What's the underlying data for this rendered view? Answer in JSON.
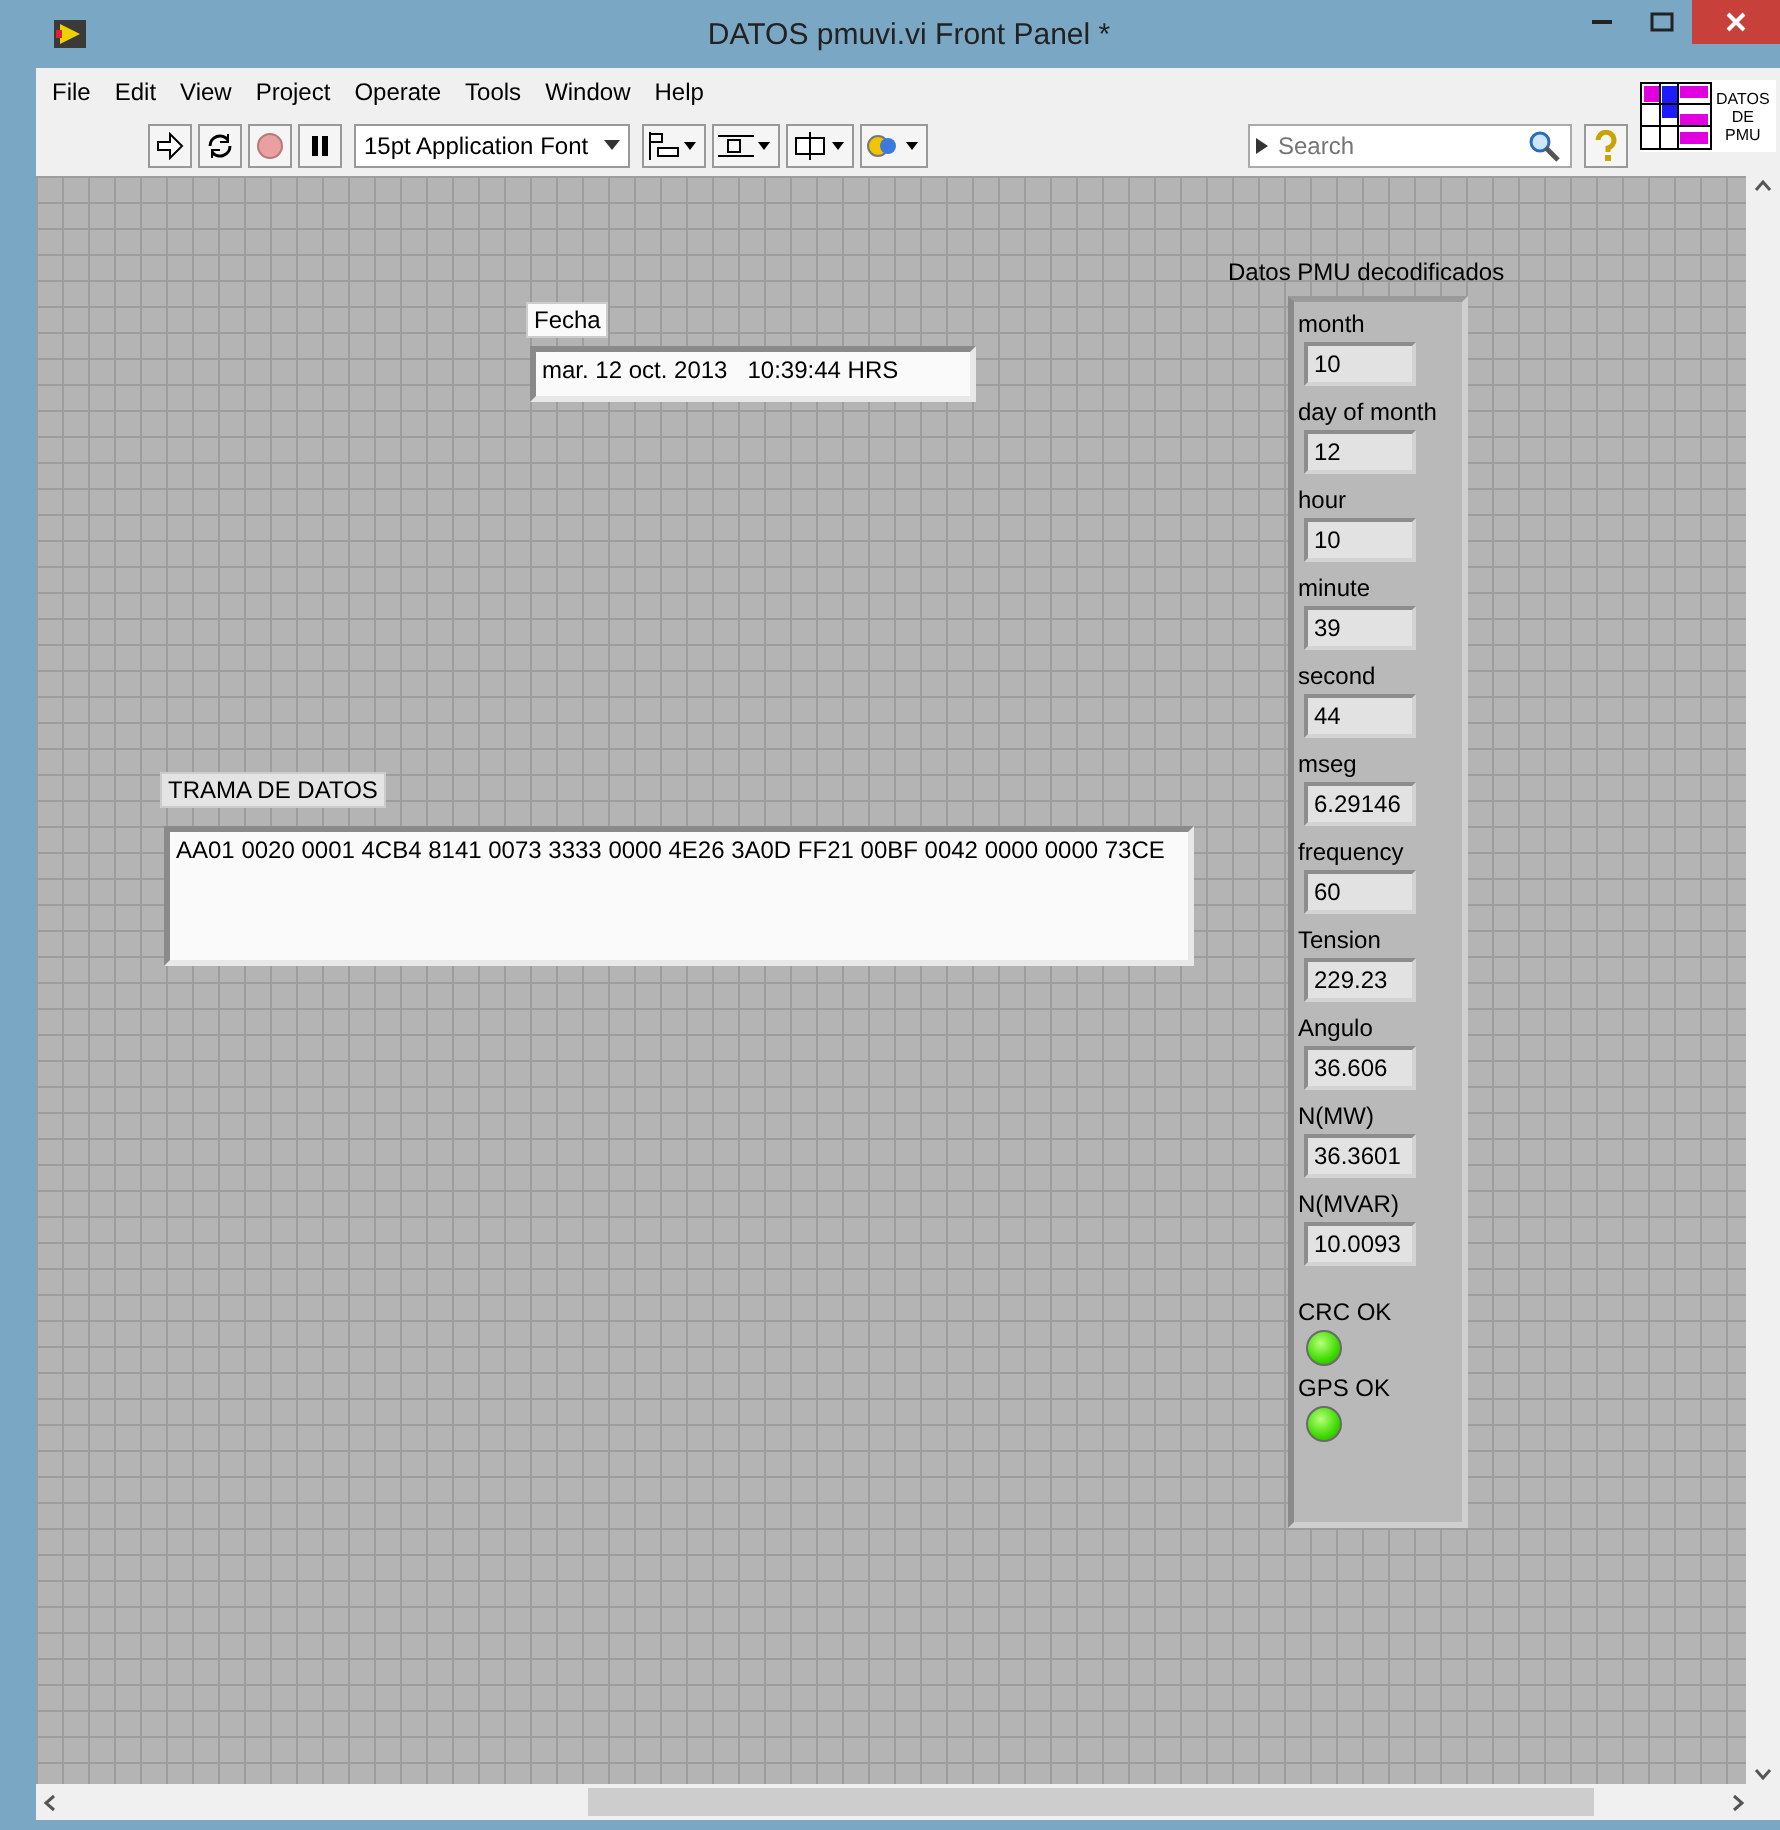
{
  "window": {
    "title": "DATOS pmuvi.vi Front Panel *"
  },
  "menu": [
    "File",
    "Edit",
    "View",
    "Project",
    "Operate",
    "Tools",
    "Window",
    "Help"
  ],
  "toolbar": {
    "font": "15pt Application Font",
    "search": {
      "placeholder": "Search"
    }
  },
  "vi_icon": {
    "lines": [
      "DATOS",
      "DE",
      "PMU"
    ]
  },
  "fecha": {
    "label": "Fecha",
    "value": "mar. 12 oct. 2013   10:39:44 HRS"
  },
  "trama": {
    "label": "TRAMA DE DATOS",
    "value": "AA01 0020 0001 4CB4 8141 0073 3333 0000 4E26 3A0D FF21 00BF 0042 0000 0000 73CE"
  },
  "cluster": {
    "label": "Datos PMU decodificados",
    "fields": [
      {
        "kind": "numeric",
        "label": "month",
        "value": "10"
      },
      {
        "kind": "numeric",
        "label": "day of month",
        "value": "12"
      },
      {
        "kind": "numeric",
        "label": "hour",
        "value": "10"
      },
      {
        "kind": "numeric",
        "label": "minute",
        "value": "39"
      },
      {
        "kind": "numeric",
        "label": "second",
        "value": "44"
      },
      {
        "kind": "numeric",
        "label": "mseg",
        "value": "6.29146"
      },
      {
        "kind": "numeric",
        "label": "frequency",
        "value": "60"
      },
      {
        "kind": "numeric",
        "label": "Tension",
        "value": "229.23"
      },
      {
        "kind": "numeric",
        "label": "Angulo",
        "value": "36.606"
      },
      {
        "kind": "numeric",
        "label": "N(MW)",
        "value": "36.3601"
      },
      {
        "kind": "numeric",
        "label": "N(MVAR)",
        "value": "10.0093"
      },
      {
        "kind": "led",
        "label": "CRC  OK",
        "on": true
      },
      {
        "kind": "led",
        "label": "GPS OK",
        "on": true
      }
    ]
  }
}
